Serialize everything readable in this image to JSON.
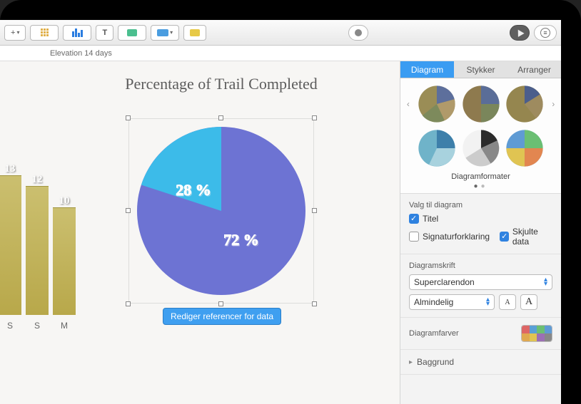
{
  "chart_data": [
    {
      "type": "pie",
      "title": "Percentage of Trail Completed",
      "series": [
        {
          "name": "",
          "values": [
            28,
            72
          ]
        }
      ],
      "labels": [
        "28 %",
        "72 %"
      ],
      "colors": [
        "#3cbbe9",
        "#6d73d3"
      ]
    },
    {
      "type": "bar",
      "categories": [
        "S",
        "S",
        "M"
      ],
      "values": [
        13,
        12,
        10
      ],
      "ylim": [
        0,
        14
      ]
    }
  ],
  "subheader": {
    "title": "Elevation 14 days"
  },
  "bar": {
    "v0": "13",
    "v1": "12",
    "v2": "10",
    "c0": "S",
    "c1": "S",
    "c2": "M"
  },
  "pie": {
    "title": "Percentage of Trail Completed",
    "slice_small": "28 %",
    "slice_large": "72 %",
    "edit_button": "Rediger referencer for data"
  },
  "inspector": {
    "tabs": {
      "diagram": "Diagram",
      "stykker": "Stykker",
      "arranger": "Arranger"
    },
    "styles_label": "Diagramformater",
    "options_title": "Valg til diagram",
    "checks": {
      "title": "Titel",
      "legend": "Signaturforklaring",
      "hidden": "Skjulte data"
    },
    "font_title": "Diagramskrift",
    "font_family": "Superclarendon",
    "font_style": "Almindelig",
    "font_small": "A",
    "font_large": "A",
    "colors_title": "Diagramfarver",
    "background_title": "Baggrund"
  }
}
